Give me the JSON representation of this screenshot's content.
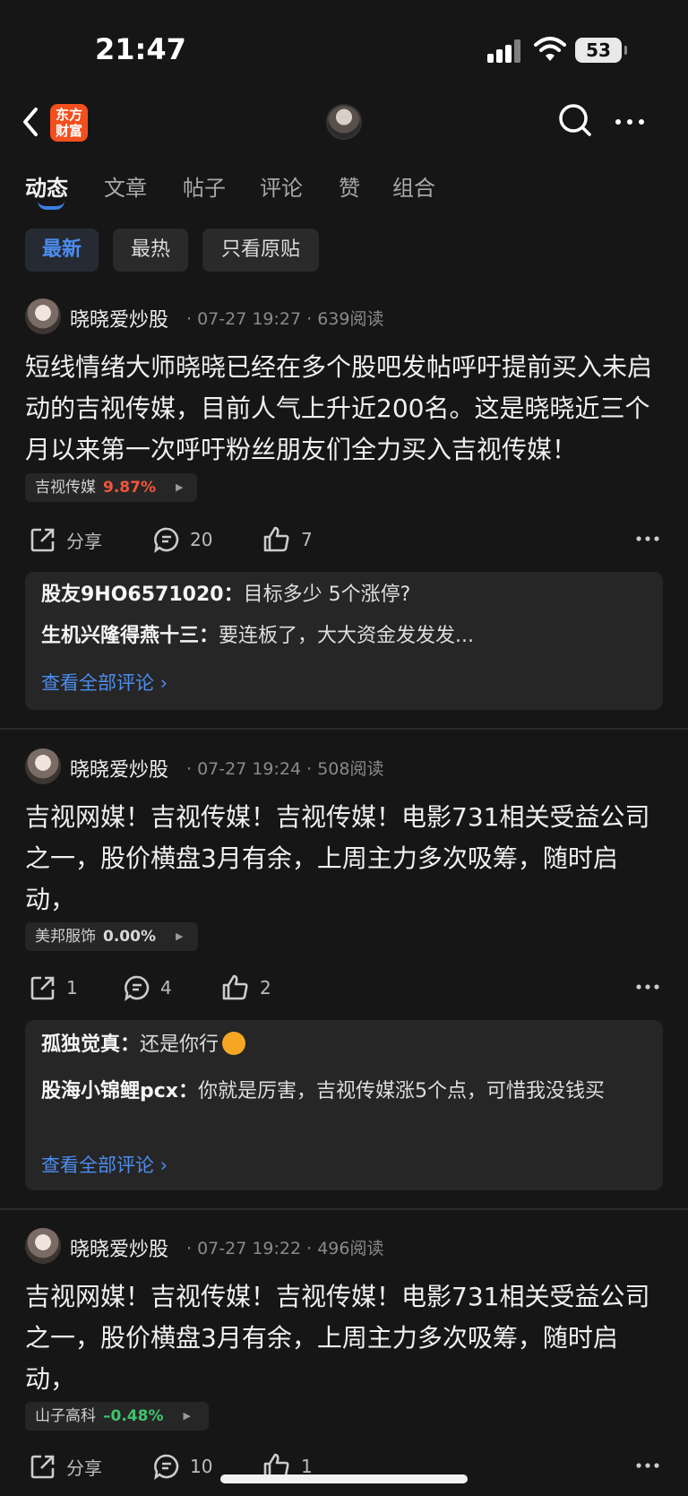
{
  "status_bar": {
    "time": "21:47",
    "battery": "53"
  },
  "nav": {
    "logo_line1": "东方",
    "logo_line2": "财富"
  },
  "tabs": [
    "动态",
    "文章",
    "帖子",
    "评论",
    "赞",
    "组合"
  ],
  "filters": [
    "最新",
    "最热",
    "只看原贴"
  ],
  "colors": {
    "up": "#f0563a",
    "down": "#3fc46b",
    "flat": "#d8d8d8",
    "link": "#4c8df0"
  },
  "posts": [
    {
      "author": "晓晓爱炒股",
      "meta": "· 07-27 19:27 · 639阅读",
      "text": "短线情绪大师晓晓已经在多个股吧发帖呼吁提前买入未启动的吉视传媒，目前人气上升近200名。这是晓晓近三个月以来第一次呼吁粉丝朋友们全力买入吉视传媒！",
      "stock": {
        "name": "吉视传媒",
        "pct": "9.87%"
      },
      "share": "分享",
      "comments": "20",
      "likes": "7",
      "replies": [
        {
          "name": "股友9HO6571020：",
          "text": "目标多少 5个涨停?"
        },
        {
          "name": "生机兴隆得燕十三：",
          "text": "要连板了，大大资金发发发..."
        }
      ],
      "see_all": "查看全部评论 ›"
    },
    {
      "author": "晓晓爱炒股",
      "meta": "· 07-27 19:24 · 508阅读",
      "text": "吉视网媒！吉视传媒！吉视传媒！电影731相关受益公司之一，股价横盘3月有余，上周主力多次吸筹，随时启动，",
      "stock": {
        "name": "美邦服饰",
        "pct": "0.00%"
      },
      "share": "1",
      "comments": "4",
      "likes": "2",
      "replies": [
        {
          "name": "孤独觉真：",
          "text": "还是你行"
        },
        {
          "name": "股海小锦鲤pcx：",
          "text": "你就是厉害，吉视传媒涨5个点，可惜我没钱买"
        }
      ],
      "see_all": "查看全部评论 ›"
    },
    {
      "author": "晓晓爱炒股",
      "meta": "· 07-27 19:22 · 496阅读",
      "text": "吉视网媒！吉视传媒！吉视传媒！电影731相关受益公司之一，股价横盘3月有余，上周主力多次吸筹，随时启动，",
      "stock": {
        "name": "山子高科",
        "pct": "–0.48%"
      },
      "share": "分享",
      "comments": "10",
      "likes": "1"
    }
  ]
}
